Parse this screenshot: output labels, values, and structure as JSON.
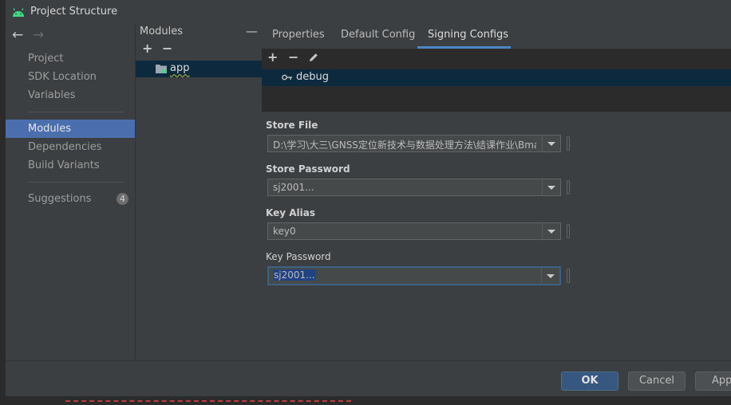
{
  "window": {
    "title": "Project Structure"
  },
  "nav": {
    "back_icon": "←",
    "forward_icon": "→",
    "items": [
      {
        "label": "Project"
      },
      {
        "label": "SDK Location"
      },
      {
        "label": "Variables"
      },
      {
        "label": "Modules"
      },
      {
        "label": "Dependencies"
      },
      {
        "label": "Build Variants"
      },
      {
        "label": "Suggestions",
        "badge": "4"
      }
    ]
  },
  "modules": {
    "title": "Modules",
    "collapse_icon": "—",
    "add_icon": "+",
    "remove_icon": "−",
    "items": [
      {
        "label": "app"
      }
    ]
  },
  "tabs": [
    {
      "label": "Properties"
    },
    {
      "label": "Default Config"
    },
    {
      "label": "Signing Configs"
    }
  ],
  "configs": {
    "add_icon": "+",
    "remove_icon": "−",
    "edit_icon": "pencil-icon",
    "items": [
      {
        "label": "debug"
      }
    ]
  },
  "form": {
    "store_file": {
      "label": "Store File",
      "value": "D:\\学习\\大三\\GNSS定位新技术与数据处理方法\\结课作业\\Bma"
    },
    "store_password": {
      "label": "Store Password",
      "value": "sj2001..."
    },
    "key_alias": {
      "label": "Key Alias",
      "value": "key0"
    },
    "key_password": {
      "label": "Key Password",
      "value": "sj2001..."
    }
  },
  "buttons": {
    "ok": "OK",
    "cancel": "Cancel",
    "apply": "App"
  },
  "colors": {
    "accent": "#4b6eaf",
    "tab_underline": "#4a88c7",
    "primary_button": "#365880",
    "android_green": "#3ddc84"
  }
}
